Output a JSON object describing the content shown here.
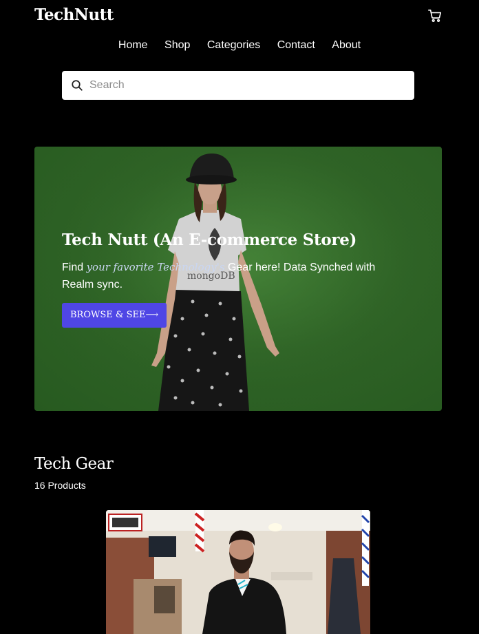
{
  "header": {
    "logo": "TechNutt",
    "cart_icon": "cart-icon"
  },
  "nav": {
    "items": [
      {
        "label": "Home"
      },
      {
        "label": "Shop"
      },
      {
        "label": "Categories"
      },
      {
        "label": "Contact"
      },
      {
        "label": "About"
      }
    ]
  },
  "search": {
    "placeholder": "Search",
    "value": "",
    "icon": "search-icon"
  },
  "hero": {
    "title": "Tech Nutt (An E-commerce Store)",
    "text_before": "Find ",
    "text_emphasis": "your favorite Technology's",
    "text_after": " Gear here! Data Synched with Realm sync.",
    "button_label": "BROWSE & SEE",
    "button_arrow": "⟶",
    "image_shirt_text": "mongoDB"
  },
  "section": {
    "title": "Tech Gear",
    "count": "16 Products"
  },
  "colors": {
    "background": "#000000",
    "hero_green": "#2f6326",
    "accent": "#4f46e5"
  }
}
